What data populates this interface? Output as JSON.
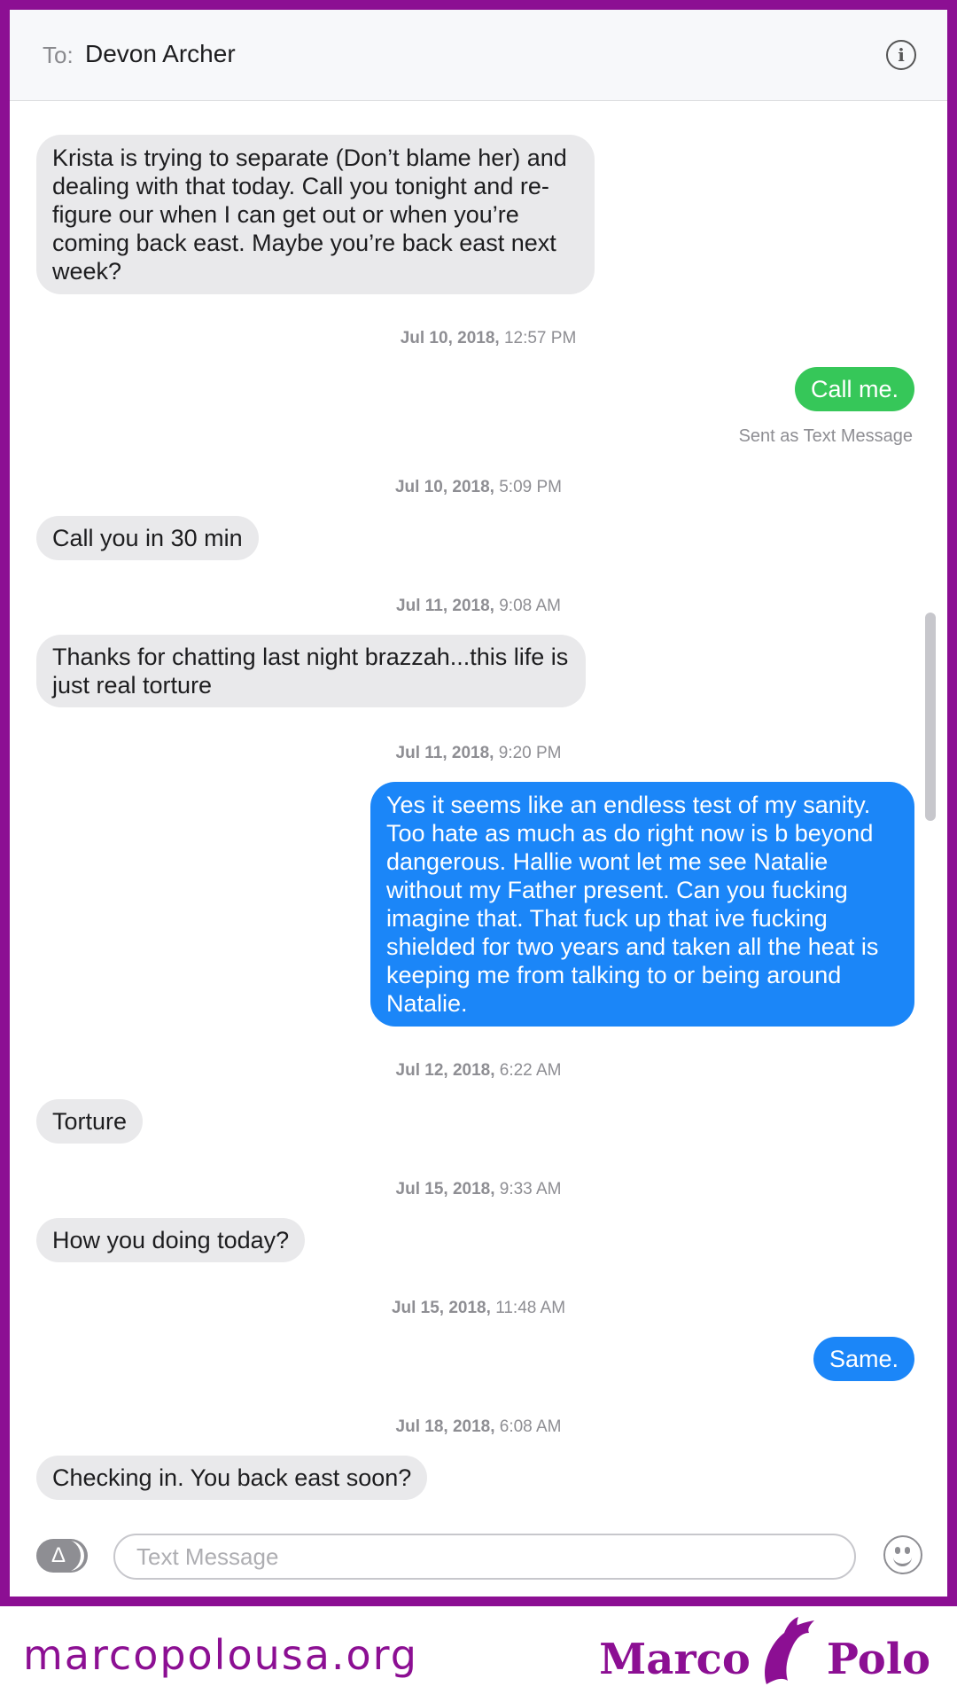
{
  "header": {
    "to_label": "To:",
    "recipient": "Devon Archer",
    "info_icon": "info-icon"
  },
  "conversation": [
    {
      "type": "in",
      "text": "Krista is trying to separate (Don’t blame her) and dealing with that today.  Call you tonight and re-figure our when I can get out or when you’re coming back east. Maybe you’re back east next week?"
    },
    {
      "type": "timestamp",
      "date": "Jul 10, 2018,",
      "time": "12:57 PM"
    },
    {
      "type": "out",
      "color": "green",
      "text": "Call me.",
      "note": "Sent as Text Message"
    },
    {
      "type": "timestamp",
      "date": "Jul 10, 2018,",
      "time": "5:09 PM"
    },
    {
      "type": "in",
      "text": "Call you in 30 min"
    },
    {
      "type": "timestamp",
      "date": "Jul 11, 2018,",
      "time": "9:08 AM"
    },
    {
      "type": "in",
      "text": "Thanks for chatting last night brazzah...this life is just real torture"
    },
    {
      "type": "timestamp",
      "date": "Jul 11, 2018,",
      "time": "9:20 PM"
    },
    {
      "type": "out",
      "color": "blue",
      "text": "Yes it seems like an endless test of my sanity.  Too hate as much as do right now is b beyond dangerous.  Hallie wont let me see Natalie without my Father present.  Can you fucking imagine that. That fuck up that ive fucking shielded for two years and taken all the heat is  keeping me from talking to or being around Natalie."
    },
    {
      "type": "timestamp",
      "date": "Jul 12, 2018,",
      "time": "6:22 AM"
    },
    {
      "type": "in",
      "text": "Torture"
    },
    {
      "type": "timestamp",
      "date": "Jul 15, 2018,",
      "time": "9:33 AM"
    },
    {
      "type": "in",
      "text": "How you doing today?"
    },
    {
      "type": "timestamp",
      "date": "Jul 15, 2018,",
      "time": "11:48 AM"
    },
    {
      "type": "out",
      "color": "blue",
      "text": "Same."
    },
    {
      "type": "timestamp",
      "date": "Jul 18, 2018,",
      "time": "6:08 AM"
    },
    {
      "type": "in",
      "text": "Checking in.  You back east soon?"
    }
  ],
  "compose": {
    "placeholder": "Text Message",
    "apps_icon": "app-store-icon",
    "emoji_icon": "emoji-icon"
  },
  "footer": {
    "website": "marcopolousa.org",
    "brand_left": "Marco",
    "brand_right": "Polo"
  },
  "colors": {
    "border": "#8c0f93",
    "incoming_bubble": "#e9e9eb",
    "sms_bubble": "#36c759",
    "imessage_bubble": "#1b86f8"
  }
}
